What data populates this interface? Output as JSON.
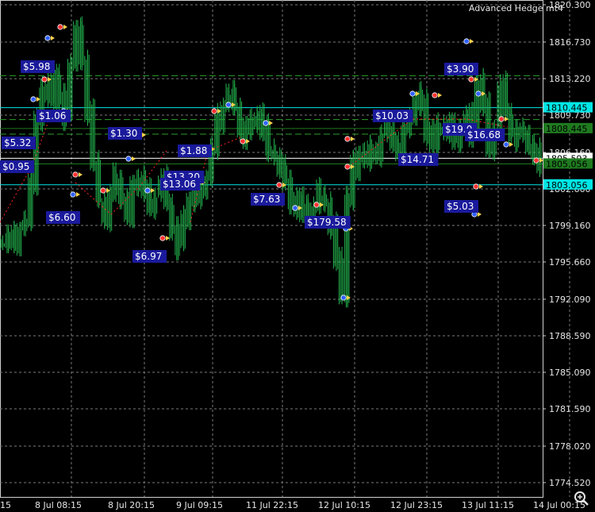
{
  "ea_title": "Advanced Hedge mt4",
  "zoom_icon": "magnifier-plus-icon",
  "colors": {
    "background": "#000000",
    "grid": "#7a7a7a",
    "candles": "#22b14c",
    "label_bg": "#1a1a9c",
    "level_cyan": "#00e6e6",
    "level_green": "#1f7a1f",
    "level_white": "#ffffff",
    "dash_green": "#2aa12a",
    "trade_red": "#ff2020",
    "trade_blue": "#3050ff"
  },
  "price_axis": {
    "ticks": [
      "1820.300",
      "1816.730",
      "1813.220",
      "1809.730",
      "1806.160",
      "1802.660",
      "1799.160",
      "1795.660",
      "1792.090",
      "1788.590",
      "1785.090",
      "1781.590",
      "1778.020",
      "1774.520"
    ],
    "level_labels": [
      {
        "text": "1810.445",
        "style": "cyan"
      },
      {
        "text": "1808.445",
        "style": "green"
      },
      {
        "text": "1805.593",
        "style": "white"
      },
      {
        "text": "1805.056",
        "style": "green"
      },
      {
        "text": "1803.056",
        "style": "cyan"
      }
    ]
  },
  "time_axis": {
    "ticks": [
      "15",
      "8 Jul 08:15",
      "8 Jul 20:15",
      "9 Jul 09:15",
      "11 Jul 22:15",
      "12 Jul 10:15",
      "12 Jul 23:15",
      "13 Jul 11:15",
      "14 Jul 00:15"
    ]
  },
  "profit_labels": [
    "$5.98",
    "$1.06",
    "$5.32",
    "$0.95",
    "$6.60",
    "$1.30",
    "$1.88",
    "$13.20",
    "$13.06",
    "$6.97",
    "$7.63",
    "$179.58",
    "$10.03",
    "$14.71",
    "$3.90",
    "$19.0",
    "$16.68",
    "$5.03"
  ],
  "chart_data": {
    "type": "candlestick",
    "price_range": [
      1774.52,
      1820.3
    ],
    "close_series": [
      1797.5,
      1798.2,
      1797.8,
      1798.8,
      1799.6,
      1803.3,
      1809.7,
      1812.4,
      1811.2,
      1813.6,
      1811.4,
      1809.8,
      1814.9,
      1817.8,
      1815.3,
      1810.3,
      1805.0,
      1801.8,
      1800.1,
      1802.1,
      1803.8,
      1801.7,
      1800.5,
      1802.6,
      1803.9,
      1802.4,
      1801.3,
      1802.1,
      1803.6,
      1801.5,
      1799.0,
      1797.4,
      1799.7,
      1801.7,
      1802.7,
      1802.3,
      1803.8,
      1806.7,
      1809.5,
      1810.7,
      1811.7,
      1810.7,
      1808.6,
      1808.0,
      1809.0,
      1809.9,
      1808.5,
      1806.8,
      1805.6,
      1804.6,
      1803.8,
      1801.8,
      1800.4,
      1801.5,
      1800.5,
      1800.9,
      1802.4,
      1801.4,
      1799.1,
      1796.4,
      1792.3,
      1801.9,
      1805.0,
      1806.1,
      1805.3,
      1806.5,
      1806.3,
      1807.8,
      1808.7,
      1807.1,
      1806.6,
      1808.2,
      1809.7,
      1810.9,
      1811.6,
      1808.3,
      1806.8,
      1808.6,
      1809.0,
      1808.6,
      1807.1,
      1808.7,
      1809.6,
      1808.2,
      1813.2,
      1810.6,
      1806.9,
      1808.6,
      1812.6,
      1810.2,
      1808.3,
      1807.8,
      1808.1,
      1806.9,
      1806.2,
      1805.4
    ]
  }
}
